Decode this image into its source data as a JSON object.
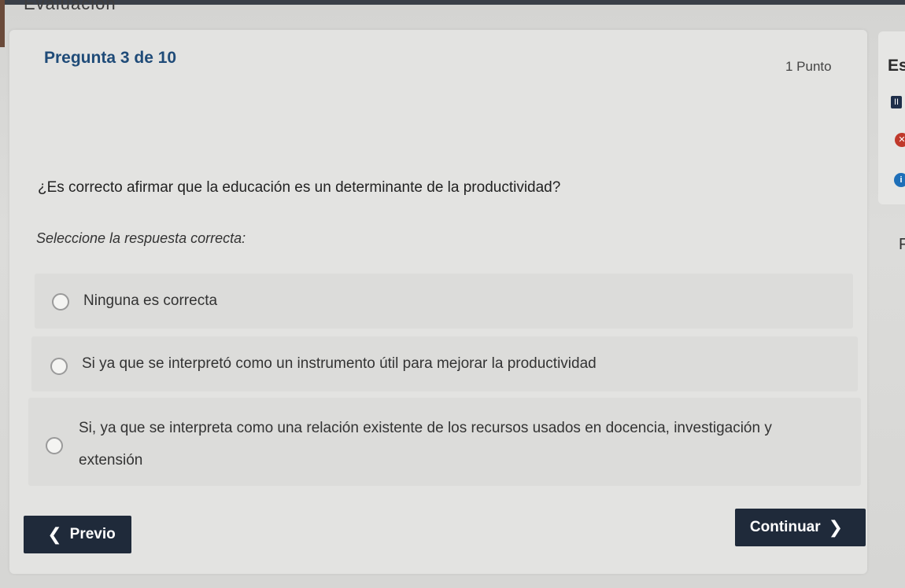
{
  "header": {
    "title": "Evaluación"
  },
  "question": {
    "title": "Pregunta 3 de 10",
    "points": "1 Punto",
    "text": "¿Es correcto afirmar que la educación es un determinante de la productividad?",
    "instruction": "Seleccione la respuesta correcta:",
    "options": [
      {
        "label": "Ninguna es correcta",
        "selected": false
      },
      {
        "label": "Si ya que se interpretó como un instrumento útil para mejorar la productividad",
        "selected": false
      },
      {
        "label": "Si, ya que se interpreta como una relación existente de los recursos usados en docencia, investigación y extensión",
        "selected": false
      }
    ]
  },
  "nav": {
    "prev_label": "Previo",
    "next_label": "Continuar"
  },
  "side_panel": {
    "title_fragment": "Es",
    "pause_icon": "pause-icon",
    "close_icon": "close-icon",
    "info_icon": "info-icon",
    "fragment": "F"
  },
  "colors": {
    "title_blue": "#1f4b78",
    "button_dark": "#1f2a3a",
    "close_red": "#c0392b",
    "info_blue": "#1e6fb8"
  }
}
